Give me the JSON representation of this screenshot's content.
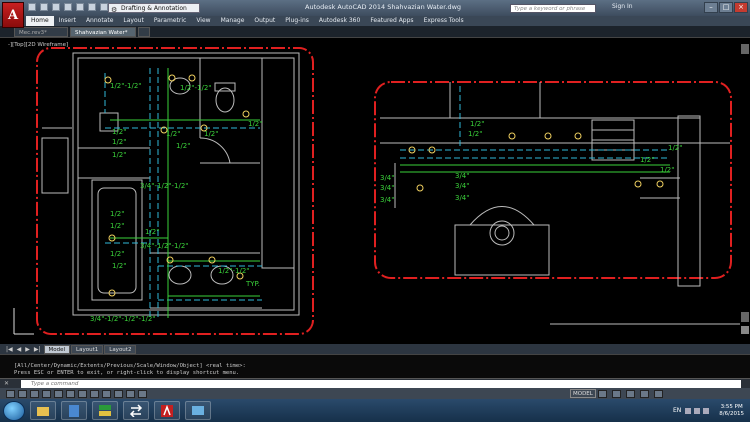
{
  "titlebar": {
    "title": "Autodesk AutoCAD 2014   Shahvazian Water.dwg",
    "workspace": "Drafting & Annotation",
    "search_placeholder": "Type a keyword or phrase",
    "sign_in": "Sign In",
    "app_letter": "A"
  },
  "ribbon_tabs": [
    "Home",
    "Insert",
    "Annotate",
    "Layout",
    "Parametric",
    "View",
    "Manage",
    "Output",
    "Plug-ins",
    "Autodesk 360",
    "Featured Apps",
    "Express Tools"
  ],
  "doc_tabs": [
    "Mec.rev3*",
    "Shahvazian Water*"
  ],
  "viewport_label": "-][Top][2D Wireframe]",
  "drawing_labels": {
    "half": "1/2\"",
    "three_quarter": "3/4\"",
    "dim_a": "1/2\"-1/2\"",
    "dim_b": "3/4\"-1/2\"-1/2\"",
    "dim_c": "3/4\"-1/2\"-1/2\"",
    "dim_d": "1/2\"-1/2\"",
    "typ": "TYP.",
    "bottom_dim": "3/4\"-1/2\"-1/2\"-1/2\""
  },
  "layout_tabs": [
    "Model",
    "Layout1",
    "Layout2"
  ],
  "command": {
    "line1": "[All/Center/Dynamic/Extents/Previous/Scale/Window/Object] <real time>:",
    "line2": "Press ESC or ENTER to exit, or right-click to display shortcut menu.",
    "placeholder": "Type a command"
  },
  "status": {
    "model": "MODEL"
  },
  "taskbar": {
    "lang": "EN",
    "time": "3:55 PM",
    "date": "8/6/2015"
  },
  "colors": {
    "titlebar": "#3d4c5e",
    "border_red": "#e02020",
    "pipe_green": "#3ad23a",
    "pipe_cyan": "#2fb8d8"
  }
}
